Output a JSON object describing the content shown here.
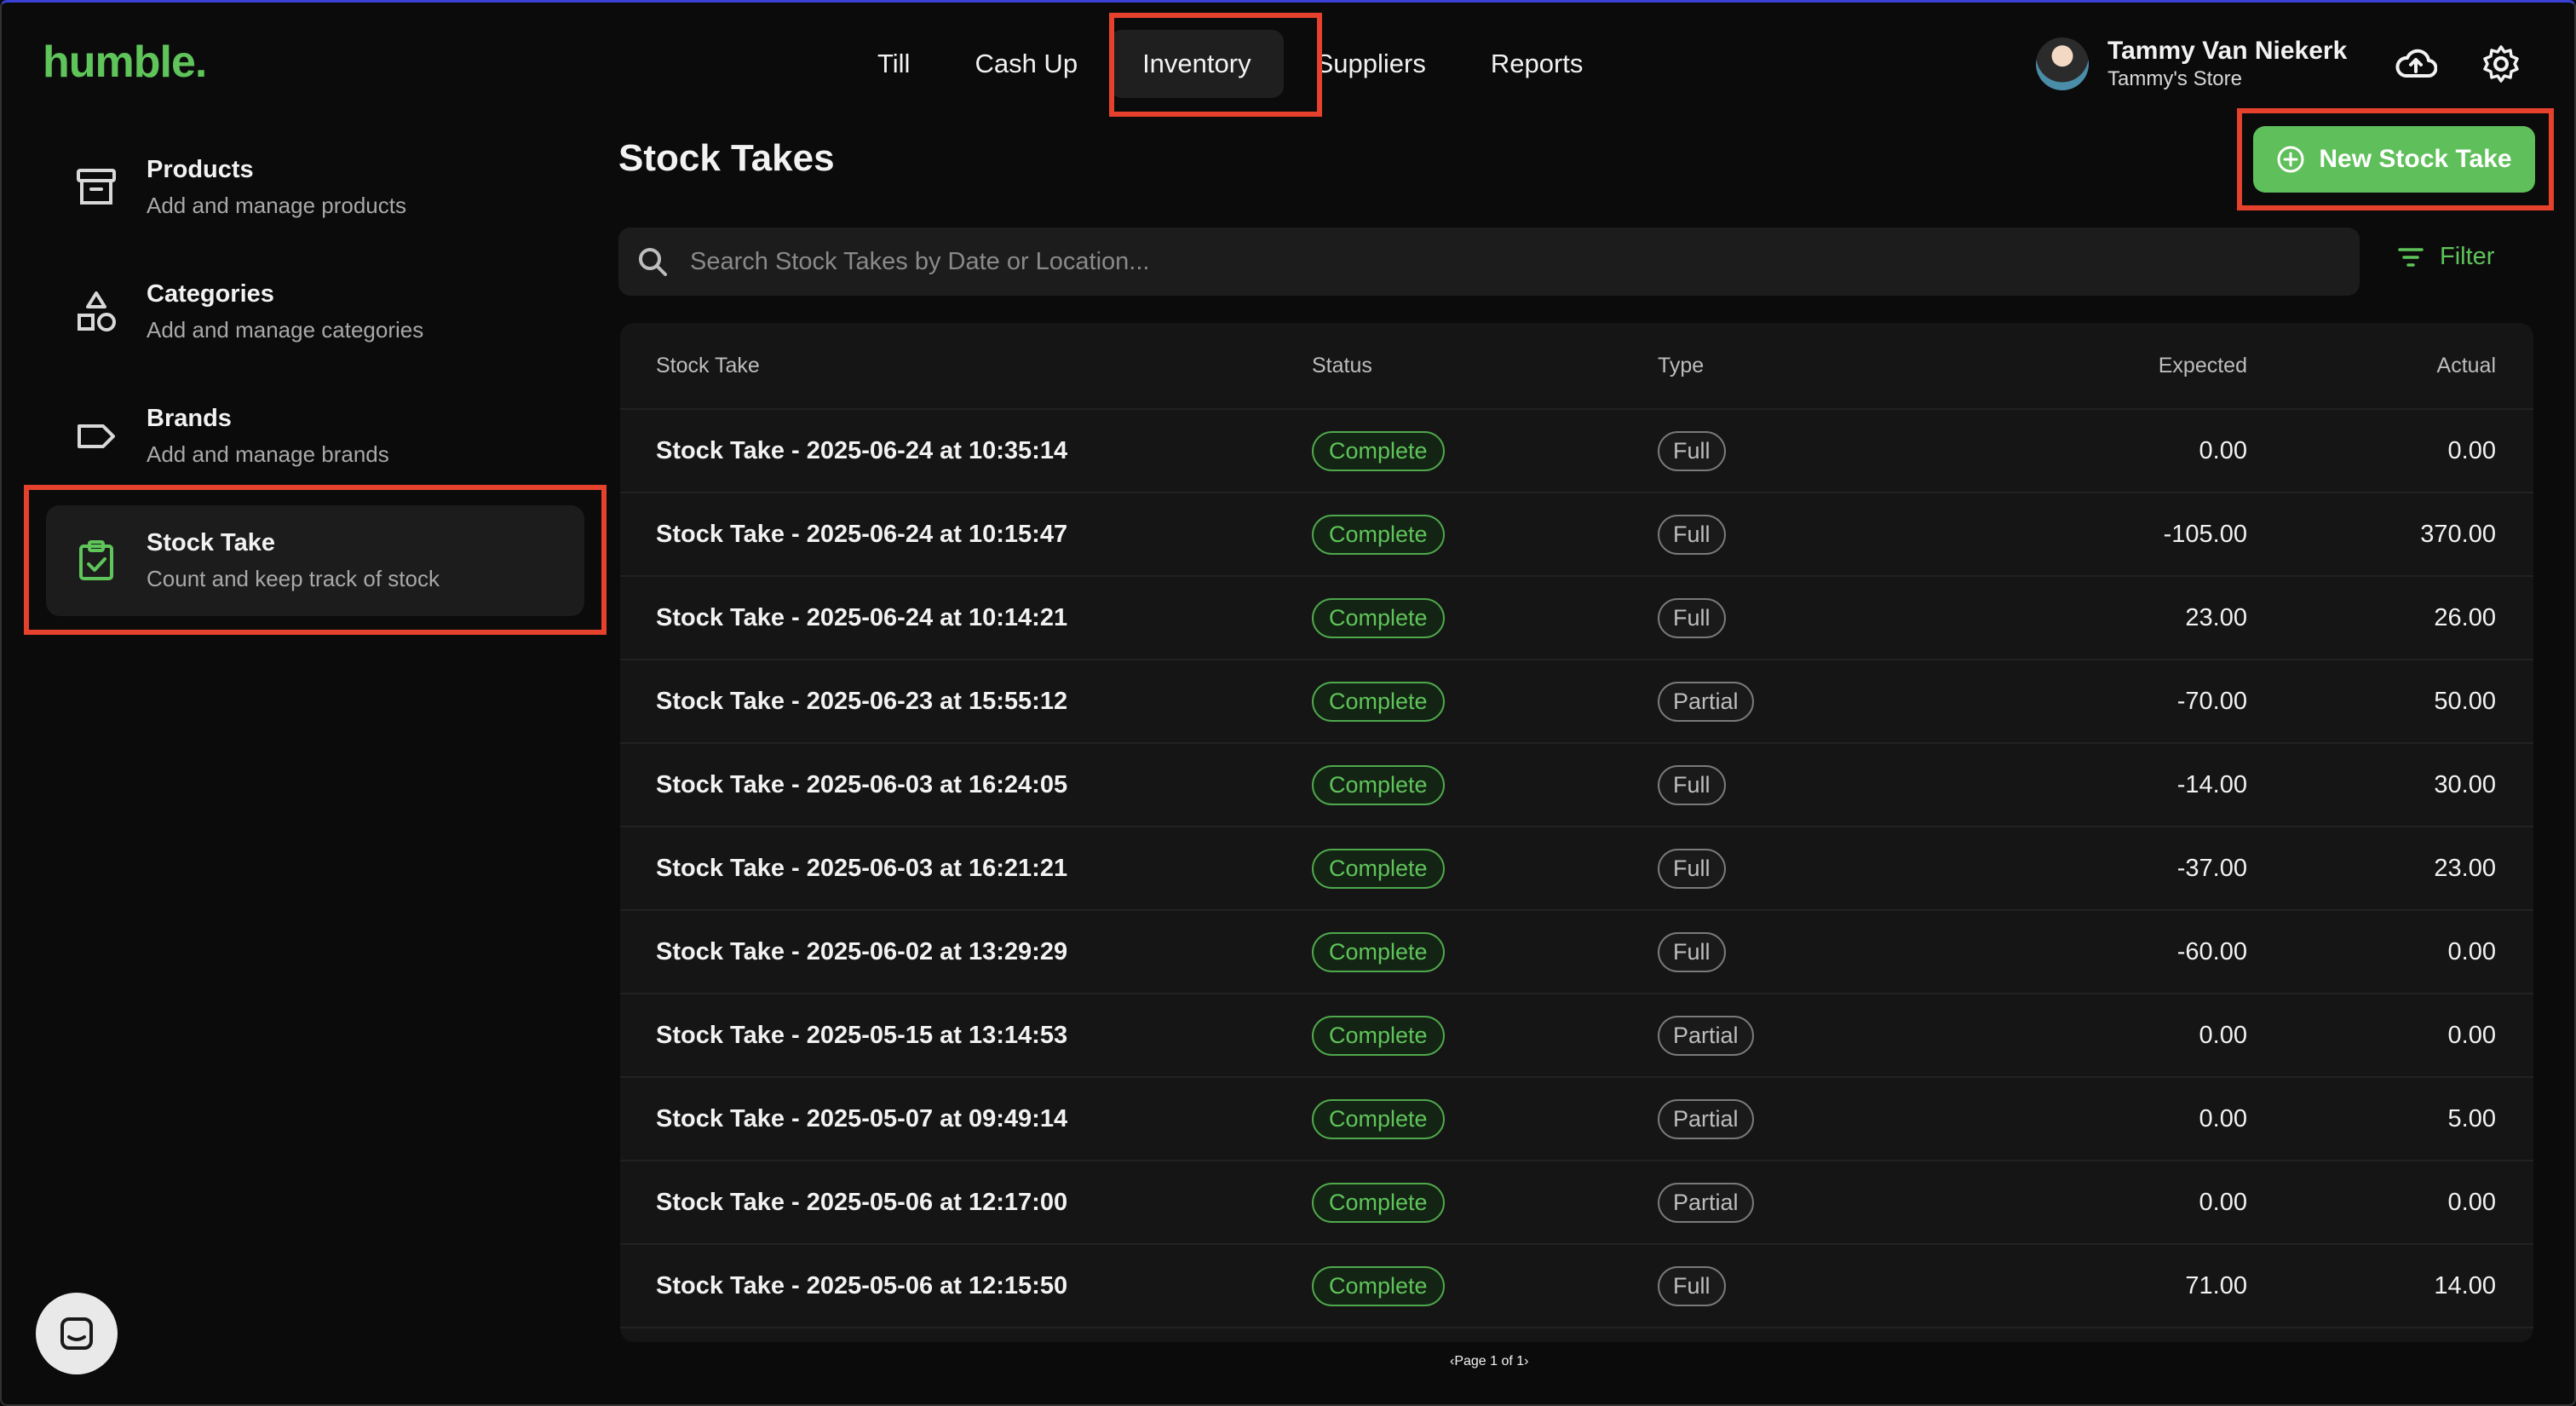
{
  "app": {
    "logo": "humble.",
    "nav": [
      "Till",
      "Cash Up",
      "Inventory",
      "Suppliers",
      "Reports"
    ],
    "active_nav": "Inventory",
    "user": {
      "name": "Tammy Van Niekerk",
      "store": "Tammy's Store"
    },
    "icons": {
      "cloud": "cloud-upload-icon",
      "settings": "gear-icon"
    },
    "accent": "#5fc45a",
    "highlight_color": "#e5412c"
  },
  "sidebar": {
    "items": [
      {
        "title": "Products",
        "subtitle": "Add and manage products",
        "icon": "archive-box-icon"
      },
      {
        "title": "Categories",
        "subtitle": "Add and manage categories",
        "icon": "shapes-icon"
      },
      {
        "title": "Brands",
        "subtitle": "Add and manage brands",
        "icon": "tag-icon"
      },
      {
        "title": "Stock Take",
        "subtitle": "Count and keep track of stock",
        "icon": "clipboard-check-icon"
      }
    ],
    "active": "Stock Take"
  },
  "main": {
    "title": "Stock Takes",
    "new_button": "New Stock Take",
    "search_placeholder": "Search Stock Takes by Date or Location...",
    "filter_label": "Filter",
    "columns": [
      "Stock Take",
      "Status",
      "Type",
      "Expected",
      "Actual"
    ],
    "rows": [
      {
        "name": "Stock Take - 2025-06-24 at 10:35:14",
        "status": "Complete",
        "type": "Full",
        "expected": "0.00",
        "actual": "0.00"
      },
      {
        "name": "Stock Take - 2025-06-24 at 10:15:47",
        "status": "Complete",
        "type": "Full",
        "expected": "-105.00",
        "actual": "370.00"
      },
      {
        "name": "Stock Take - 2025-06-24 at 10:14:21",
        "status": "Complete",
        "type": "Full",
        "expected": "23.00",
        "actual": "26.00"
      },
      {
        "name": "Stock Take - 2025-06-23 at 15:55:12",
        "status": "Complete",
        "type": "Partial",
        "expected": "-70.00",
        "actual": "50.00"
      },
      {
        "name": "Stock Take - 2025-06-03 at 16:24:05",
        "status": "Complete",
        "type": "Full",
        "expected": "-14.00",
        "actual": "30.00"
      },
      {
        "name": "Stock Take - 2025-06-03 at 16:21:21",
        "status": "Complete",
        "type": "Full",
        "expected": "-37.00",
        "actual": "23.00"
      },
      {
        "name": "Stock Take - 2025-06-02 at 13:29:29",
        "status": "Complete",
        "type": "Full",
        "expected": "-60.00",
        "actual": "0.00"
      },
      {
        "name": "Stock Take - 2025-05-15 at 13:14:53",
        "status": "Complete",
        "type": "Partial",
        "expected": "0.00",
        "actual": "0.00"
      },
      {
        "name": "Stock Take - 2025-05-07 at 09:49:14",
        "status": "Complete",
        "type": "Partial",
        "expected": "0.00",
        "actual": "5.00"
      },
      {
        "name": "Stock Take - 2025-05-06 at 12:17:00",
        "status": "Complete",
        "type": "Partial",
        "expected": "0.00",
        "actual": "0.00"
      },
      {
        "name": "Stock Take - 2025-05-06 at 12:15:50",
        "status": "Complete",
        "type": "Full",
        "expected": "71.00",
        "actual": "14.00"
      }
    ],
    "pagination": "Page 1 of 1"
  },
  "support": {
    "icon": "chat-icon"
  }
}
